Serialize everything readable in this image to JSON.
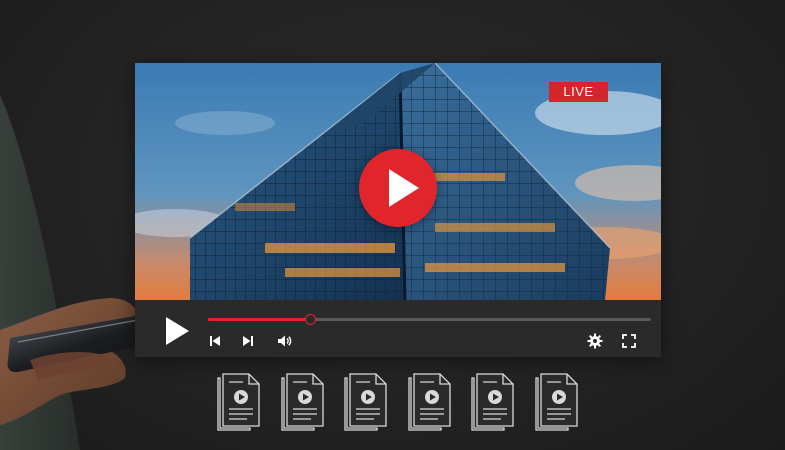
{
  "player": {
    "live_label": "LIVE",
    "progress": 0.23,
    "accent_color": "#e0262b",
    "icons": {
      "center_play": "play-circle-icon",
      "overlay_play": "play-icon",
      "previous": "skip-previous-icon",
      "next": "skip-next-icon",
      "volume": "volume-icon",
      "settings": "gear-icon",
      "fullscreen": "fullscreen-icon"
    }
  },
  "files": {
    "count": 6,
    "icon": "video-file-icon"
  }
}
